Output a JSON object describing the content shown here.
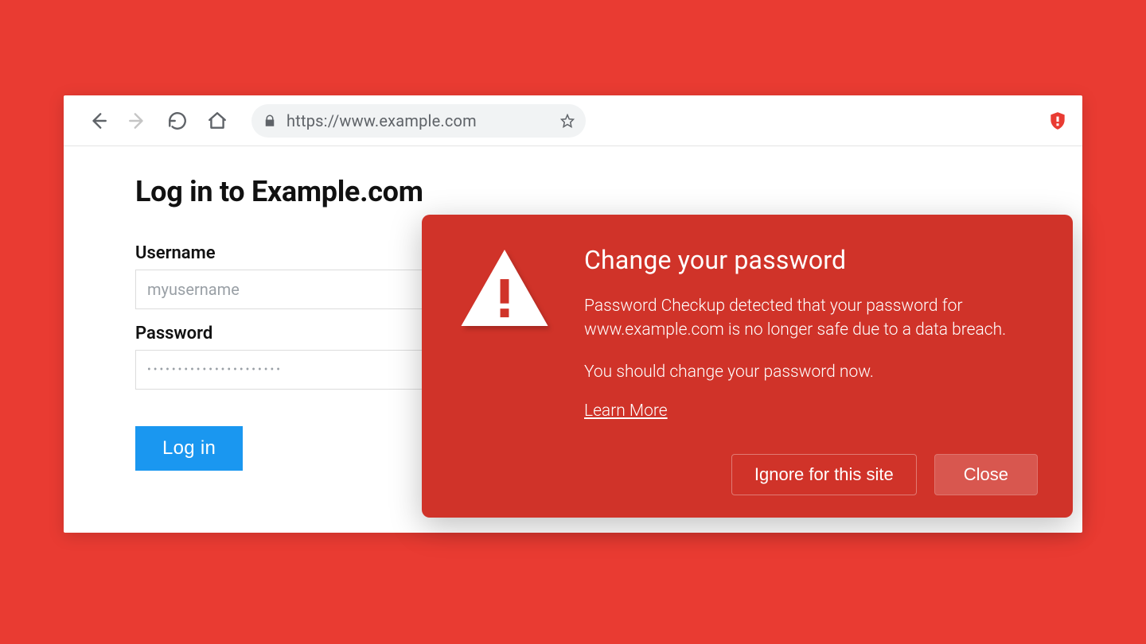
{
  "toolbar": {
    "url": "https://www.example.com"
  },
  "page": {
    "heading": "Log in to Example.com",
    "username_label": "Username",
    "username_value": "myusername",
    "password_label": "Password",
    "password_value": "••••••••••••••••••••••",
    "login_button": "Log in"
  },
  "alert": {
    "title": "Change your password",
    "body1": "Password Checkup detected that your password for www.example.com is no longer safe due to a data breach.",
    "body2": "You should change your password now.",
    "learn_more": "Learn More",
    "ignore": "Ignore for this site",
    "close": "Close"
  },
  "icons": {
    "back": "back-icon",
    "forward": "forward-icon",
    "reload": "reload-icon",
    "home": "home-icon",
    "lock": "lock-icon",
    "star": "star-icon",
    "extension": "password-checkup-extension-icon",
    "warning": "warning-triangle-icon"
  },
  "colors": {
    "page_bg": "#e93b32",
    "alert_bg": "#d03329",
    "login_btn": "#1a97f0"
  }
}
